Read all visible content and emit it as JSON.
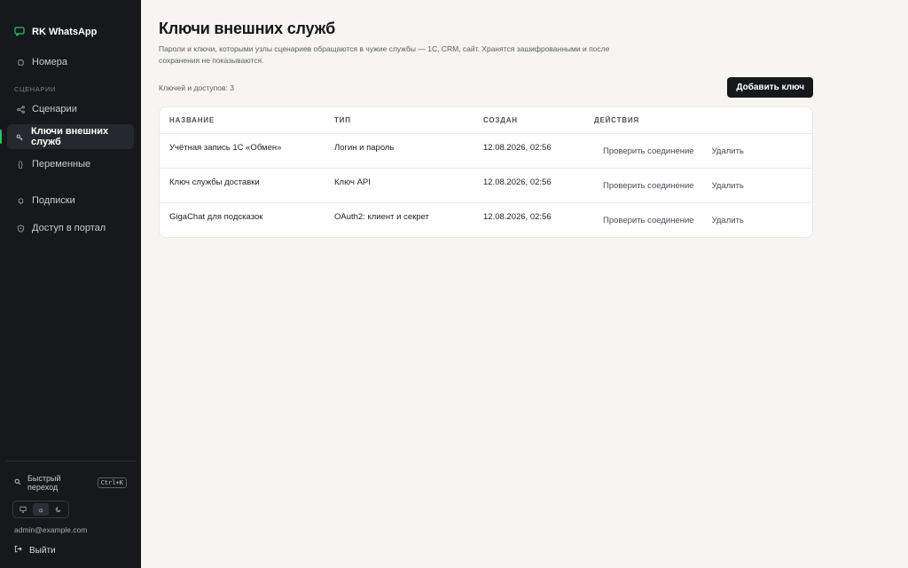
{
  "brand": {
    "name": "RK WhatsApp",
    "accent": "#22c55e"
  },
  "sidebar": {
    "items_top": [
      {
        "label": "Номера",
        "icon": "phone-icon"
      }
    ],
    "section_label": "СЦЕНАРИИ",
    "items_section": [
      {
        "label": "Сценарии",
        "icon": "share-icon"
      },
      {
        "label": "Ключи внешних служб",
        "icon": "key-icon",
        "active": true
      },
      {
        "label": "Переменные",
        "icon": "braces-icon"
      }
    ],
    "items_bottom": [
      {
        "label": "Подписки",
        "icon": "bell-icon"
      },
      {
        "label": "Доступ в портал",
        "icon": "shield-icon"
      }
    ],
    "footer": {
      "quick_label": "Быстрый переход",
      "shortcut": "Ctrl+K",
      "theme_options": [
        "monitor-icon",
        "sun-icon",
        "moon-icon"
      ],
      "theme_selected": "sun-icon",
      "email": "admin@example.com",
      "logout": "Выйти"
    }
  },
  "main": {
    "title": "Ключи внешних служб",
    "subtitle": "Пароли и ключи, которыми узлы сценариев обращаются в чужие службы — 1С, CRM, сайт. Хранятся зашифрованными и после сохранения не показываются.",
    "count_label": "Ключей и доступов: 3",
    "add_button": "Добавить ключ",
    "table": {
      "headers": [
        "Название",
        "Тип",
        "Создан",
        "Действия"
      ],
      "rows": [
        {
          "name": "Учётная запись 1С «Обмен»",
          "type": "Логин и пароль",
          "created": "12.08.2026, 02:56",
          "check": "Проверить соединение",
          "delete": "Удалить"
        },
        {
          "name": "Ключ службы доставки",
          "type": "Ключ API",
          "created": "12.08.2026, 02:56",
          "check": "Проверить соединение",
          "delete": "Удалить"
        },
        {
          "name": "GigaChat для подсказок",
          "type": "OAuth2: клиент и секрет",
          "created": "12.08.2026, 02:56",
          "check": "Проверить соединение",
          "delete": "Удалить"
        }
      ]
    }
  }
}
